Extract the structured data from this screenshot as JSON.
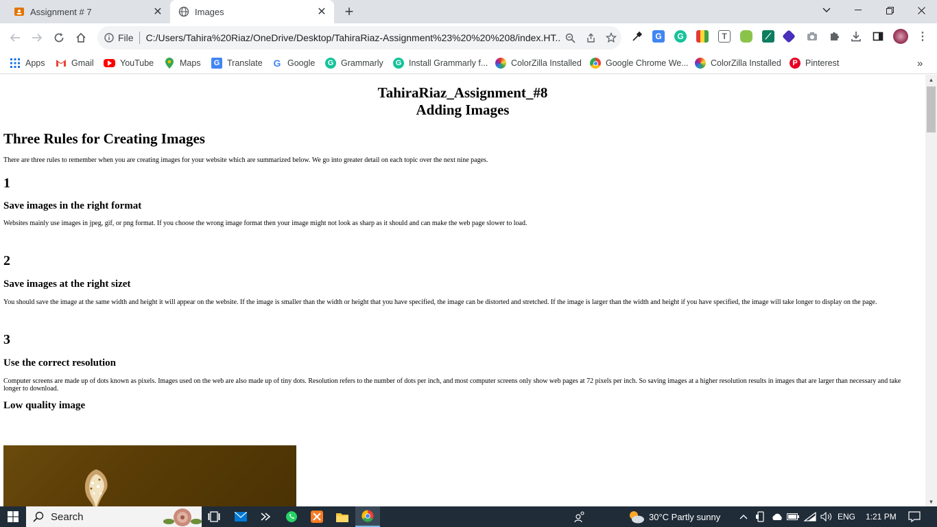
{
  "tabs": [
    {
      "title": "Assignment # 7",
      "favicon": "classroom-icon",
      "active": false
    },
    {
      "title": "Images",
      "favicon": "globe-icon",
      "active": true
    }
  ],
  "omnibox": {
    "file_label": "File",
    "url": "C:/Users/Tahira%20Riaz/OneDrive/Desktop/TahiraRiaz-Assignment%23%20%20%208/index.HT..."
  },
  "bookmarks": [
    {
      "label": "Apps",
      "icon": "apps-grid-icon"
    },
    {
      "label": "Gmail",
      "icon": "gmail-icon"
    },
    {
      "label": "YouTube",
      "icon": "youtube-icon"
    },
    {
      "label": "Maps",
      "icon": "maps-icon"
    },
    {
      "label": "Translate",
      "icon": "translate-icon"
    },
    {
      "label": "Google",
      "icon": "google-icon"
    },
    {
      "label": "Grammarly",
      "icon": "grammarly-icon"
    },
    {
      "label": "Install Grammarly f...",
      "icon": "grammarly-icon"
    },
    {
      "label": "ColorZilla Installed",
      "icon": "colorzilla-icon"
    },
    {
      "label": "Google Chrome We...",
      "icon": "chrome-icon"
    },
    {
      "label": "ColorZilla Installed",
      "icon": "colorzilla-icon"
    },
    {
      "label": "Pinterest",
      "icon": "pinterest-icon"
    }
  ],
  "page": {
    "title_line1": "TahiraRiaz_Assignment_#8",
    "title_line2": "Adding Images",
    "section_heading": "Three Rules for Creating Images",
    "intro": "There are three rules to remember when you are creating images for your website which are summarized below. We go into greater detail on each topic over the next nine pages.",
    "rules": [
      {
        "number": "1",
        "heading": "Save images in the right format",
        "text": "Websites mainly use images in jpeg, gif, or png format. If you choose the wrong image format then your image might not look as sharp as it should and can make the web page slower to load."
      },
      {
        "number": "2",
        "heading": "Save images at the right sizet",
        "text": "You should save the image at the same width and height it will appear on the website. If the image is smaller than the width or height that you have specified, the image can be distorted and stretched. If the image is larger than the width and height if you have specified, the image will take longer to display on the page."
      },
      {
        "number": "3",
        "heading": "Use the correct resolution",
        "text": "Computer screens are made up of dots known as pixels. Images used on the web are also made up of tiny dots. Resolution refers to the number of dots per inch, and most computer screens only show web pages at 72 pixels per inch. So saving images at a higher resolution results in images that are larger than necessary and take longer to download."
      }
    ],
    "image_heading": "Low quality image"
  },
  "taskbar": {
    "search_label": "Search",
    "weather": "30°C  Partly sunny",
    "language": "ENG",
    "time": "1:21 PM"
  },
  "colors": {
    "tab_strip": "#dee1e6",
    "taskbar": "#202c38",
    "classroom": "#e37400",
    "youtube": "#ff0000",
    "pinterest": "#e60023",
    "grammarly": "#15c39a"
  }
}
